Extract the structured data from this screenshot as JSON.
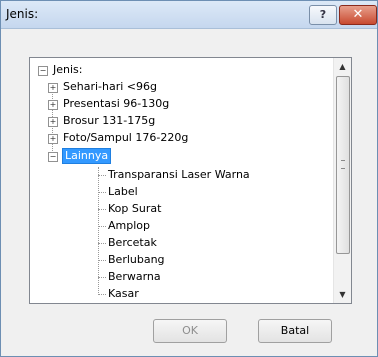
{
  "window": {
    "title": "Jenis:",
    "help_label": "?",
    "close_label": "✕"
  },
  "tree": {
    "root": "Jenis:",
    "items": [
      "Sehari-hari <96g",
      "Presentasi 96-130g",
      "Brosur 131-175g",
      "Foto/Sampul 176-220g",
      "Lainnya"
    ],
    "children": [
      "Transparansi Laser Warna",
      "Label",
      "Kop Surat",
      "Amplop",
      "Bercetak",
      "Berlubang",
      "Berwarna",
      "Kasar"
    ]
  },
  "buttons": {
    "ok": "OK",
    "cancel": "Batal"
  }
}
